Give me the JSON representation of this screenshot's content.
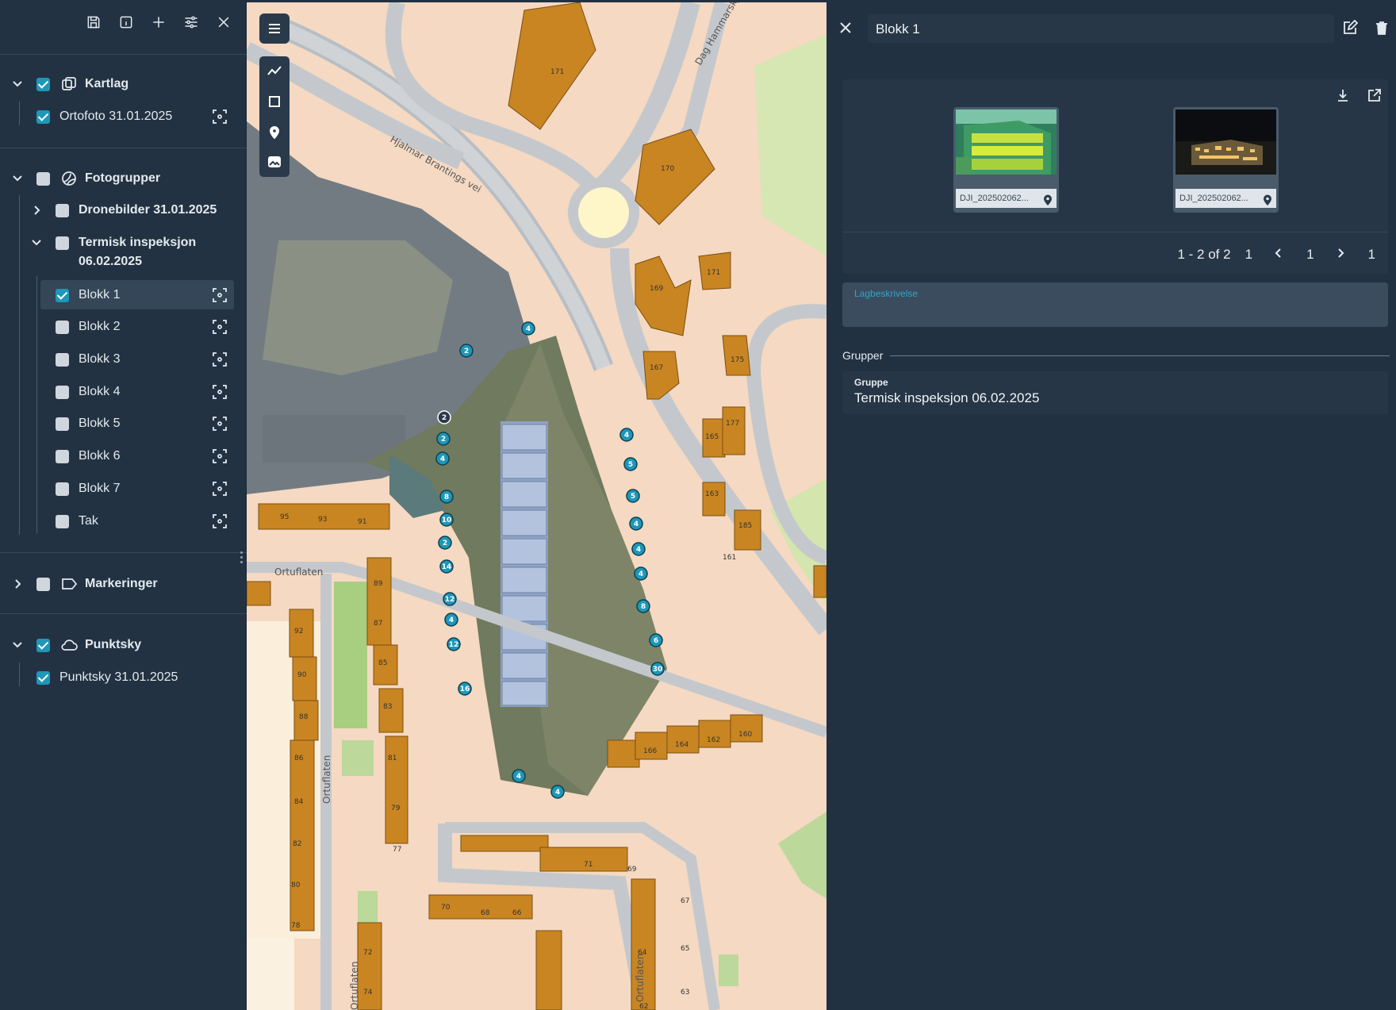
{
  "left_panel": {
    "toolbar": [
      "save-icon",
      "info-icon",
      "plus-icon",
      "sliders-icon",
      "close-icon"
    ],
    "groups": {
      "kartlag": {
        "label": "Kartlag",
        "checked": true,
        "items": [
          {
            "label": "Ortofoto 31.01.2025",
            "checked": true
          }
        ]
      },
      "fotogrupper": {
        "label": "Fotogrupper",
        "checked": false,
        "dronebilder": {
          "label": "Dronebilder 31.01.2025",
          "checked": false
        },
        "termisk": {
          "label_line1": "Termisk inspeksjon",
          "label_line2": "06.02.2025",
          "checked": false
        },
        "items": [
          {
            "label": "Blokk 1",
            "checked": true,
            "selected": true
          },
          {
            "label": "Blokk 2",
            "checked": false
          },
          {
            "label": "Blokk 3",
            "checked": false
          },
          {
            "label": "Blokk 4",
            "checked": false
          },
          {
            "label": "Blokk 5",
            "checked": false
          },
          {
            "label": "Blokk 6",
            "checked": false
          },
          {
            "label": "Blokk 7",
            "checked": false
          },
          {
            "label": "Tak",
            "checked": false
          }
        ]
      },
      "markeringer": {
        "label": "Markeringer",
        "checked": false
      },
      "punktsky": {
        "label": "Punktsky",
        "checked": true,
        "items": [
          {
            "label": "Punktsky 31.01.2025",
            "checked": true
          }
        ]
      }
    }
  },
  "map": {
    "street_labels": [
      "Hjalmar Brantings vei",
      "Dag Hammarskjölds vei",
      "Ortuflaten",
      "Ortuflaten",
      "Ortuflaten",
      "Ortuflaten"
    ],
    "building_numbers": [
      "171",
      "170",
      "169",
      "171",
      "167",
      "175",
      "165",
      "177",
      "163",
      "185",
      "161",
      "160",
      "162",
      "164",
      "166",
      "95",
      "93",
      "91",
      "89",
      "87",
      "85",
      "83",
      "81",
      "79",
      "77",
      "92",
      "90",
      "88",
      "86",
      "84",
      "82",
      "80",
      "78",
      "71",
      "69",
      "70",
      "68",
      "66",
      "67",
      "65",
      "63",
      "64",
      "62",
      "72",
      "74"
    ],
    "markers": [
      "4",
      "2",
      "2",
      "2",
      "4",
      "8",
      "10",
      "2",
      "14",
      "12",
      "4",
      "12",
      "16",
      "4",
      "5",
      "5",
      "4",
      "4",
      "4",
      "8",
      "6",
      "30",
      "4",
      "4"
    ],
    "tools": [
      "menu-icon",
      "polyline-icon",
      "polygon-icon",
      "pin-icon",
      "image-icon"
    ]
  },
  "right_panel": {
    "title": "Blokk 1",
    "thumbs": [
      {
        "caption": "DJI_202502062...",
        "kind": "thermal"
      },
      {
        "caption": "DJI_202502062...",
        "kind": "night"
      }
    ],
    "pager": {
      "range": "1 - 2 of 2",
      "first": "1",
      "current": "1",
      "last": "1"
    },
    "description_label": "Lagbeskrivelse",
    "groups_heading": "Grupper",
    "group_key": "Gruppe",
    "group_value": "Termisk inspeksjon 06.02.2025"
  },
  "colors": {
    "accent": "#1e97b8",
    "panel": "#233242",
    "map_bg": "#f5d9c2",
    "building": "#c98522"
  }
}
